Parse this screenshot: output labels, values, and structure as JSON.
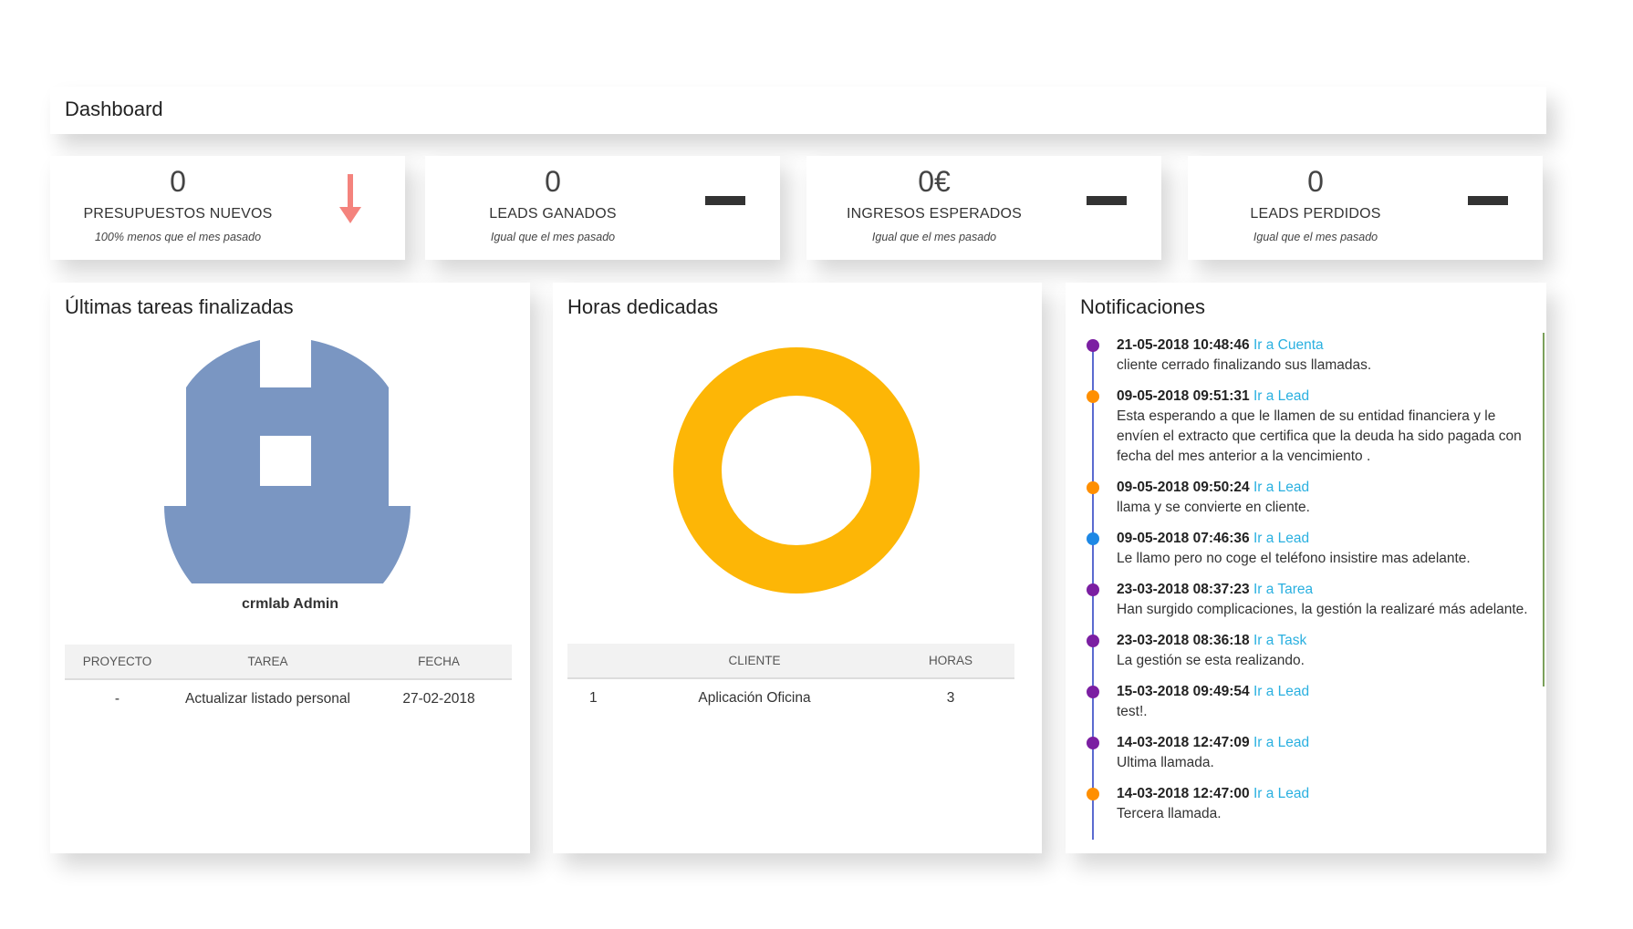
{
  "header": {
    "title": "Dashboard"
  },
  "stats": [
    {
      "value": "0",
      "label": "PRESUPUESTOS NUEVOS",
      "sub": "100% menos que el mes pasado",
      "indicator": "arrow-down",
      "color": "#f4837d"
    },
    {
      "value": "0",
      "label": "LEADS GANADOS",
      "sub": "Igual que el mes pasado",
      "indicator": "dash",
      "color": "#333333"
    },
    {
      "value": "0€",
      "label": "INGRESOS ESPERADOS",
      "sub": "Igual que el mes pasado",
      "indicator": "dash",
      "color": "#333333"
    },
    {
      "value": "0",
      "label": "LEADS PERDIDOS",
      "sub": "Igual que el mes pasado",
      "indicator": "dash",
      "color": "#333333"
    }
  ],
  "tasks": {
    "title": "Últimas tareas finalizadas",
    "user_name": "crmlab Admin",
    "avatar_color": "#7a96c2",
    "columns": [
      "PROYECTO",
      "TAREA",
      "FECHA"
    ],
    "rows": [
      {
        "project": "-",
        "task": "Actualizar listado personal",
        "date": "27-02-2018"
      }
    ]
  },
  "hours": {
    "title": "Horas dedicadas",
    "chart_data": {
      "type": "pie",
      "labels": [
        "Aplicación Oficina"
      ],
      "values": [
        3
      ],
      "colors": [
        "#fdb606"
      ]
    },
    "columns": [
      "",
      "CLIENTE",
      "HORAS"
    ],
    "rows": [
      {
        "index": "1",
        "client": "Aplicación Oficina",
        "hours": "3"
      }
    ]
  },
  "notifications": {
    "title": "Notificaciones",
    "items": [
      {
        "date": "21-05-2018 10:48:46",
        "link": "Ir a Cuenta",
        "text": "cliente cerrado finalizando sus llamadas.",
        "color": "#7b1fa2"
      },
      {
        "date": "09-05-2018 09:51:31",
        "link": "Ir a Lead",
        "text": "Esta esperando a que le llamen de su entidad financiera y le envíen el extracto que certifica que la deuda ha sido pagada con fecha del mes anterior a la vencimiento .",
        "color": "#ff8f00"
      },
      {
        "date": "09-05-2018 09:50:24",
        "link": "Ir a Lead",
        "text": "llama y se convierte en cliente.",
        "color": "#ff8f00"
      },
      {
        "date": "09-05-2018 07:46:36",
        "link": "Ir a Lead",
        "text": "Le llamo pero no coge el teléfono insistire mas adelante.",
        "color": "#1e88e5"
      },
      {
        "date": "23-03-2018 08:37:23",
        "link": "Ir a Tarea",
        "text": "Han surgido complicaciones, la gestión la realizaré más adelante.",
        "color": "#7b1fa2"
      },
      {
        "date": "23-03-2018 08:36:18",
        "link": "Ir a Task",
        "text": "La gestión se esta realizando.",
        "color": "#7b1fa2"
      },
      {
        "date": "15-03-2018 09:49:54",
        "link": "Ir a Lead",
        "text": "test!.",
        "color": "#7b1fa2"
      },
      {
        "date": "14-03-2018 12:47:09",
        "link": "Ir a Lead",
        "text": "Ultima llamada.",
        "color": "#7b1fa2"
      },
      {
        "date": "14-03-2018 12:47:00",
        "link": "Ir a Lead",
        "text": "Tercera llamada.",
        "color": "#ff8f00"
      }
    ]
  }
}
